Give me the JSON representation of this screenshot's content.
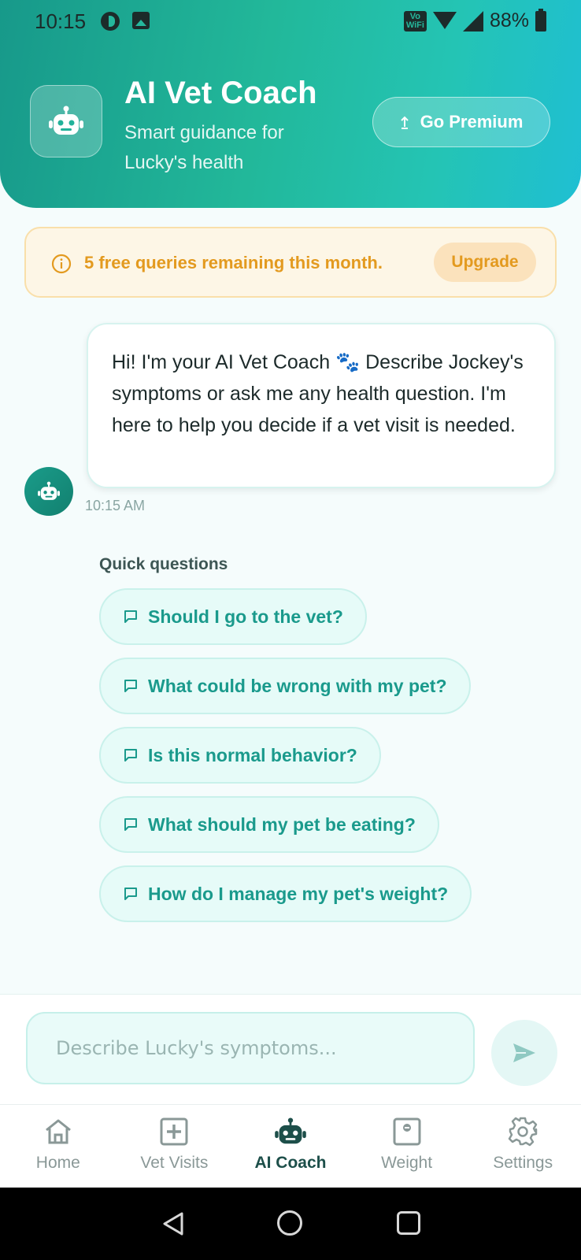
{
  "status_bar": {
    "time": "10:15",
    "vowifi_line1": "Vo",
    "vowifi_line2": "WiFi",
    "battery": "88%"
  },
  "header": {
    "title": "AI Vet Coach",
    "subtitle": "Smart guidance for Lucky's health",
    "premium_button": "Go Premium",
    "premium_icon": "upload-arrow-icon",
    "badge_icon": "robot-icon"
  },
  "banner": {
    "text": "5 free queries remaining this month.",
    "upgrade_button": "Upgrade",
    "icon": "info-icon",
    "color": "#e39a1f"
  },
  "chat": {
    "message": "Hi! I'm your AI Vet Coach 🐾 Describe Jockey's symptoms or ask me any health question. I'm here to help you decide if a vet visit is needed.",
    "timestamp": "10:15 AM",
    "avatar_icon": "robot-icon"
  },
  "quick_questions": {
    "label": "Quick questions",
    "items": [
      "Should I go to the vet?",
      "What could be wrong with my pet?",
      "Is this normal behavior?",
      "What should my pet be eating?",
      "How do I manage my pet's weight?"
    ]
  },
  "composer": {
    "placeholder": "Describe Lucky's symptoms...",
    "value": "",
    "send_icon": "send-icon"
  },
  "bottom_nav": {
    "items": [
      {
        "label": "Home",
        "icon": "home-icon"
      },
      {
        "label": "Vet Visits",
        "icon": "medical-plus-icon"
      },
      {
        "label": "AI Coach",
        "icon": "robot-icon",
        "active": true
      },
      {
        "label": "Weight",
        "icon": "scale-icon"
      },
      {
        "label": "Settings",
        "icon": "gear-icon"
      }
    ]
  },
  "colors": {
    "accent": "#1a9a8c",
    "header_gradient_start": "#17998a",
    "header_gradient_end": "#1fbfd3",
    "warning": "#e39a1f"
  }
}
